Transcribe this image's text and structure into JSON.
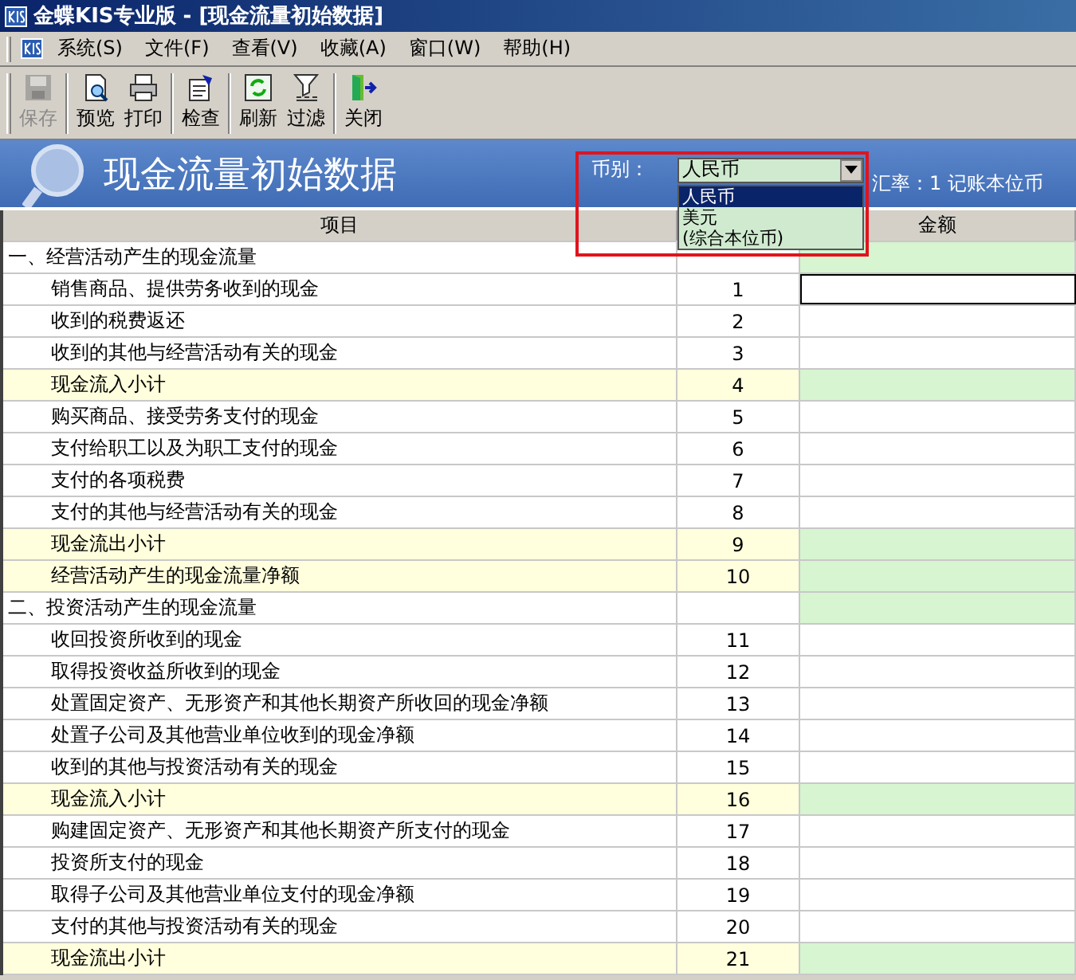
{
  "window": {
    "title": "金蝶KIS专业版 - [现金流量初始数据]"
  },
  "menu": [
    "系统(S)",
    "文件(F)",
    "查看(V)",
    "收藏(A)",
    "窗口(W)",
    "帮助(H)"
  ],
  "toolbar": [
    {
      "label": "保存",
      "disabled": true
    },
    {
      "label": "预览",
      "disabled": false
    },
    {
      "label": "打印",
      "disabled": false
    },
    {
      "label": "检查",
      "disabled": false
    },
    {
      "label": "刷新",
      "disabled": false
    },
    {
      "label": "过滤",
      "disabled": false
    },
    {
      "label": "关闭",
      "disabled": false
    }
  ],
  "header": {
    "title": "现金流量初始数据",
    "currency_label": "币别：",
    "currency_value": "人民币",
    "rate_text": "汇率：1 记账本位币",
    "currency_options": [
      {
        "label": "人民币",
        "selected": true
      },
      {
        "label": "美元",
        "selected": false
      },
      {
        "label": "(综合本位币)",
        "selected": false
      }
    ]
  },
  "table": {
    "columns": [
      "项目",
      "金额"
    ],
    "rows": [
      {
        "kind": "section",
        "item": "一、经营活动产生的现金流量"
      },
      {
        "kind": "item",
        "item": "销售商品、提供劳务收到的现金",
        "line": "1",
        "focused": true
      },
      {
        "kind": "item",
        "item": "收到的税费返还",
        "line": "2",
        "focused": false
      },
      {
        "kind": "item",
        "item": "收到的其他与经营活动有关的现金",
        "line": "3",
        "focused": false
      },
      {
        "kind": "subtotal",
        "item": "现金流入小计",
        "line": "4"
      },
      {
        "kind": "item",
        "item": "购买商品、接受劳务支付的现金",
        "line": "5",
        "focused": false
      },
      {
        "kind": "item",
        "item": "支付给职工以及为职工支付的现金",
        "line": "6",
        "focused": false
      },
      {
        "kind": "item",
        "item": "支付的各项税费",
        "line": "7",
        "focused": false
      },
      {
        "kind": "item",
        "item": "支付的其他与经营活动有关的现金",
        "line": "8",
        "focused": false
      },
      {
        "kind": "subtotal",
        "item": "现金流出小计",
        "line": "9"
      },
      {
        "kind": "subtotal",
        "item": "经营活动产生的现金流量净额",
        "line": "10"
      },
      {
        "kind": "section",
        "item": "二、投资活动产生的现金流量"
      },
      {
        "kind": "item",
        "item": "收回投资所收到的现金",
        "line": "11",
        "focused": false
      },
      {
        "kind": "item",
        "item": "取得投资收益所收到的现金",
        "line": "12",
        "focused": false
      },
      {
        "kind": "item",
        "item": "处置固定资产、无形资产和其他长期资产所收回的现金净额",
        "line": "13",
        "focused": false
      },
      {
        "kind": "item",
        "item": "处置子公司及其他营业单位收到的现金净额",
        "line": "14",
        "focused": false
      },
      {
        "kind": "item",
        "item": "收到的其他与投资活动有关的现金",
        "line": "15",
        "focused": false
      },
      {
        "kind": "subtotal",
        "item": "现金流入小计",
        "line": "16"
      },
      {
        "kind": "item",
        "item": "购建固定资产、无形资产和其他长期资产所支付的现金",
        "line": "17",
        "focused": false
      },
      {
        "kind": "item",
        "item": "投资所支付的现金",
        "line": "18",
        "focused": false
      },
      {
        "kind": "item",
        "item": "取得子公司及其他营业单位支付的现金净额",
        "line": "19",
        "focused": false
      },
      {
        "kind": "item",
        "item": "支付的其他与投资活动有关的现金",
        "line": "20",
        "focused": false
      },
      {
        "kind": "subtotal",
        "item": "现金流出小计",
        "line": "21"
      }
    ]
  }
}
